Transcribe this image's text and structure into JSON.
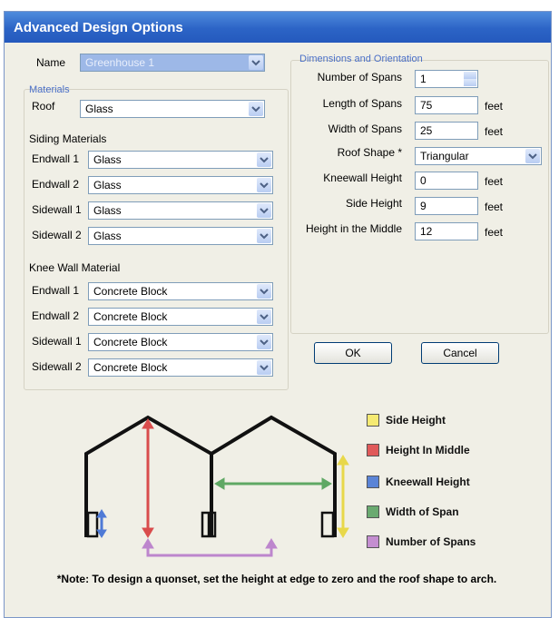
{
  "window": {
    "title": "Advanced Design Options"
  },
  "name": {
    "label": "Name",
    "value": "Greenhouse 1"
  },
  "materials": {
    "section": "Materials",
    "roof": {
      "label": "Roof",
      "value": "Glass"
    },
    "siding_heading": "Siding Materials",
    "siding": [
      {
        "label": "Endwall 1",
        "value": "Glass"
      },
      {
        "label": "Endwall 2",
        "value": "Glass"
      },
      {
        "label": "Sidewall 1",
        "value": "Glass"
      },
      {
        "label": "Sidewall 2",
        "value": "Glass"
      }
    ],
    "knee_heading": "Knee Wall Material",
    "knee": [
      {
        "label": "Endwall 1",
        "value": "Concrete Block"
      },
      {
        "label": "Endwall 2",
        "value": "Concrete Block"
      },
      {
        "label": "Sidewall 1",
        "value": "Concrete Block"
      },
      {
        "label": "Sidewall 2",
        "value": "Concrete Block"
      }
    ]
  },
  "dimensions": {
    "section": "Dimensions and Orientation",
    "spans": {
      "label": "Number of Spans",
      "value": "1"
    },
    "length": {
      "label": "Length of Spans",
      "value": "75",
      "unit": "feet"
    },
    "width": {
      "label": "Width of Spans",
      "value": "25",
      "unit": "feet"
    },
    "roof_shape": {
      "label": "Roof Shape *",
      "value": "Triangular"
    },
    "kneewall": {
      "label": "Kneewall Height",
      "value": "0",
      "unit": "feet"
    },
    "side": {
      "label": "Side Height",
      "value": "9",
      "unit": "feet"
    },
    "middle": {
      "label": "Height in the Middle",
      "value": "12",
      "unit": "feet"
    }
  },
  "buttons": {
    "ok": "OK",
    "cancel": "Cancel"
  },
  "legend": [
    {
      "label": "Side Height",
      "color": "#f5ea72"
    },
    {
      "label": "Height In Middle",
      "color": "#e05a5a"
    },
    {
      "label": "Kneewall Height",
      "color": "#5b84d6"
    },
    {
      "label": "Width of Span",
      "color": "#6aaa70"
    },
    {
      "label": "Number of Spans",
      "color": "#c48ed0"
    }
  ],
  "note": "*Note: To design a quonset, set the height at edge to zero and the roof shape to arch."
}
